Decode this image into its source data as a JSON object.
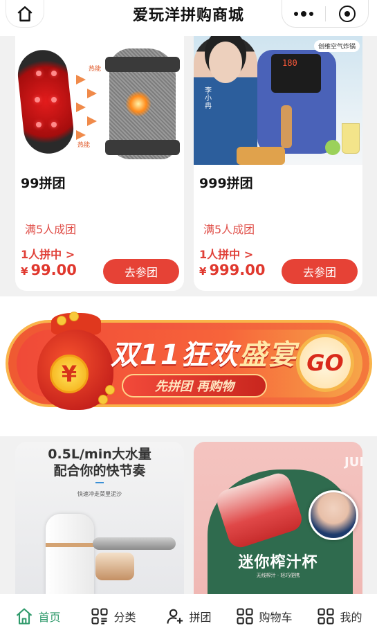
{
  "header": {
    "title": "爱玩洋拼购商城",
    "home_icon": "home-icon",
    "more_icon": "more-dots-icon",
    "close_icon": "target-close-icon"
  },
  "products": [
    {
      "name": "99拼团",
      "rule": "满5人成团",
      "joined": "1人拼中 >",
      "currency": "¥",
      "price": "99.00",
      "button": "去参团",
      "image_labels": [
        "热能",
        "热能"
      ]
    },
    {
      "name": "999拼团",
      "rule": "满5人成团",
      "joined": "1人拼中 >",
      "currency": "¥",
      "price": "999.00",
      "button": "去参团",
      "image_labels": [
        "创维空气炸锅",
        "180",
        "李小冉"
      ]
    }
  ],
  "banner": {
    "title_part1": "双11狂欢",
    "title_part2": "盛宴",
    "subtitle": "先拼团 再购物",
    "go": "GO",
    "coin_symbol": "¥"
  },
  "promo_cards": [
    {
      "headline1": "0.5L/min大水量",
      "headline2": "配合你的快节奏",
      "subline": "快速冲走菜里泥沙"
    },
    {
      "vertical": "JUIC",
      "headline": "迷你榨汁杯",
      "subline": "无线榨汁 · 轻巧便携"
    }
  ],
  "tabbar": [
    {
      "label": "首页",
      "icon": "home-icon",
      "active": true
    },
    {
      "label": "分类",
      "icon": "category-grid-icon",
      "active": false
    },
    {
      "label": "拼团",
      "icon": "group-user-add-icon",
      "active": false
    },
    {
      "label": "购物车",
      "icon": "cart-grid-icon",
      "active": false
    },
    {
      "label": "我的",
      "icon": "profile-grid-icon",
      "active": false
    }
  ],
  "colors": {
    "accent_red": "#e64236",
    "price_red": "#e0382e",
    "tab_active": "#2f9a6b"
  }
}
